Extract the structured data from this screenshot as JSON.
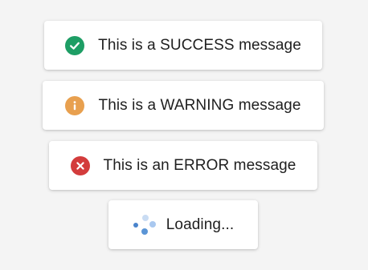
{
  "colors": {
    "background": "#f4f4f4",
    "card": "#ffffff",
    "text": "#1f1f1f",
    "success": "#1e9e65",
    "warning": "#e8a04f",
    "error": "#d33c3c",
    "loader": "#5b95d6"
  },
  "toasts": {
    "success": {
      "message": "This is a SUCCESS message",
      "icon": "check-circle-icon"
    },
    "warning": {
      "message": "This is a WARNING message",
      "icon": "info-circle-icon"
    },
    "error": {
      "message": "This is an ERROR message",
      "icon": "x-circle-icon"
    },
    "loading": {
      "message": "Loading...",
      "icon": "spinner-icon"
    }
  }
}
